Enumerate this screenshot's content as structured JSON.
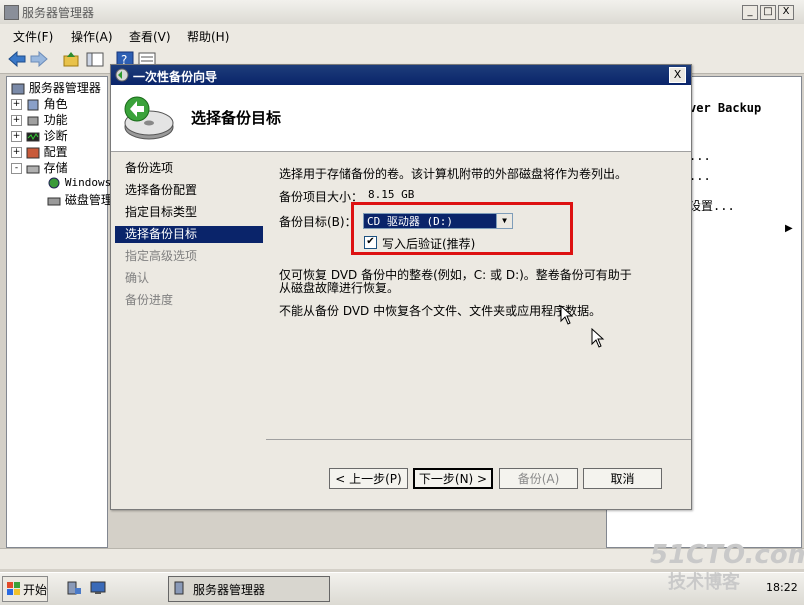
{
  "outer_window": {
    "title": "服务器管理器",
    "buttons": {
      "minimize": "_",
      "maximize": "□",
      "close": "X"
    }
  },
  "menu": [
    "文件(F)",
    "操作(A)",
    "查看(V)",
    "帮助(H)"
  ],
  "tree": {
    "root": "服务器管理器",
    "items": [
      {
        "label": "角色",
        "expander": "+"
      },
      {
        "label": "功能",
        "expander": "+"
      },
      {
        "label": "诊断",
        "expander": "+"
      },
      {
        "label": "配置",
        "expander": "+"
      },
      {
        "label": "存储",
        "expander": "-"
      }
    ],
    "children": [
      "Windows",
      "磁盘管理"
    ]
  },
  "right_panel": {
    "lines": [
      "ver Backup",
      "...",
      "...",
      "设置...",
      ""
    ]
  },
  "wizard": {
    "title": "一次性备份向导",
    "heading": "选择备份目标",
    "close": "X",
    "steps": [
      {
        "label": "备份选项",
        "state": "normal"
      },
      {
        "label": "选择备份配置",
        "state": "normal"
      },
      {
        "label": "指定目标类型",
        "state": "normal"
      },
      {
        "label": "选择备份目标",
        "state": "active"
      },
      {
        "label": "指定高级选项",
        "state": "disabled"
      },
      {
        "label": "确认",
        "state": "disabled"
      },
      {
        "label": "备份进度",
        "state": "disabled"
      }
    ],
    "intro": "选择用于存储备份的卷。该计算机附带的外部磁盘将作为卷列出。",
    "size_label": "备份项目大小：",
    "size_value": "8.15 GB",
    "target_label": "备份目标(B)：",
    "target_value": "CD 驱动器 (D:)",
    "verify_label": "写入后验证(推荐)",
    "verify_checked": true,
    "note1_line1": "仅可恢复 DVD 备份中的整卷(例如，C: 或 D:)。整卷备份可有助于",
    "note1_line2": "从磁盘故障进行恢复。",
    "note2": "不能从备份 DVD 中恢复各个文件、文件夹或应用程序数据。",
    "buttons": {
      "back": "< 上一步(P)",
      "next": "下一步(N) >",
      "backup": "备份(A)",
      "cancel": "取消"
    }
  },
  "taskbar": {
    "start": "开始",
    "task": "服务器管理器",
    "clock": "18:22"
  },
  "watermark": {
    "line1": "51CTO.com",
    "line2": "技术博客"
  }
}
